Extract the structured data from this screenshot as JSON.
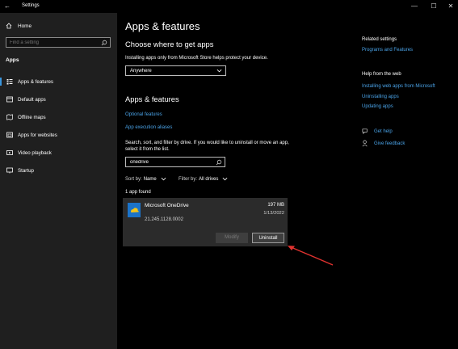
{
  "window": {
    "title": "Settings",
    "back_glyph": "←",
    "controls": [
      "—",
      "☐",
      "✕"
    ]
  },
  "sidebar": {
    "home_label": "Home",
    "search_placeholder": "Find a setting",
    "section_label": "Apps",
    "items": [
      {
        "label": "Apps & features",
        "icon": "apps-features-icon",
        "active": true
      },
      {
        "label": "Default apps",
        "icon": "default-apps-icon"
      },
      {
        "label": "Offline maps",
        "icon": "map-icon"
      },
      {
        "label": "Apps for websites",
        "icon": "web-apps-icon"
      },
      {
        "label": "Video playback",
        "icon": "video-icon"
      },
      {
        "label": "Startup",
        "icon": "startup-icon"
      }
    ]
  },
  "main": {
    "title": "Apps & features",
    "choose": {
      "heading": "Choose where to get apps",
      "description": "Installing apps only from Microsoft Store helps protect your device.",
      "dropdown_value": "Anywhere"
    },
    "apps": {
      "heading": "Apps & features",
      "optional_link": "Optional features",
      "aliases_link": "App execution aliases",
      "search_desc": "Search, sort, and filter by drive. If you would like to uninstall or move an app, select it from the list.",
      "search_value": "onedrive",
      "sort_label": "Sort by:",
      "sort_value": "Name",
      "filter_label": "Filter by:",
      "filter_value": "All drives",
      "count_text": "1 app found"
    },
    "app_item": {
      "name": "Microsoft OneDrive",
      "version": "21.245.1128.0002",
      "size": "197 MB",
      "date": "1/13/2022",
      "modify_label": "Modify",
      "uninstall_label": "Uninstall"
    }
  },
  "right": {
    "related_heading": "Related settings",
    "related_links": [
      "Programs and Features"
    ],
    "help_heading": "Help from the web",
    "help_links": [
      "Installing web apps from Microsoft",
      "Uninstalling apps",
      "Updating apps"
    ],
    "get_help": "Get help",
    "give_feedback": "Give feedback"
  },
  "colors": {
    "accent": "#4aa3e8",
    "arrow": "#e0322f",
    "sidebar_bg": "#1f1f1f",
    "card_bg": "#2b2b2b"
  }
}
